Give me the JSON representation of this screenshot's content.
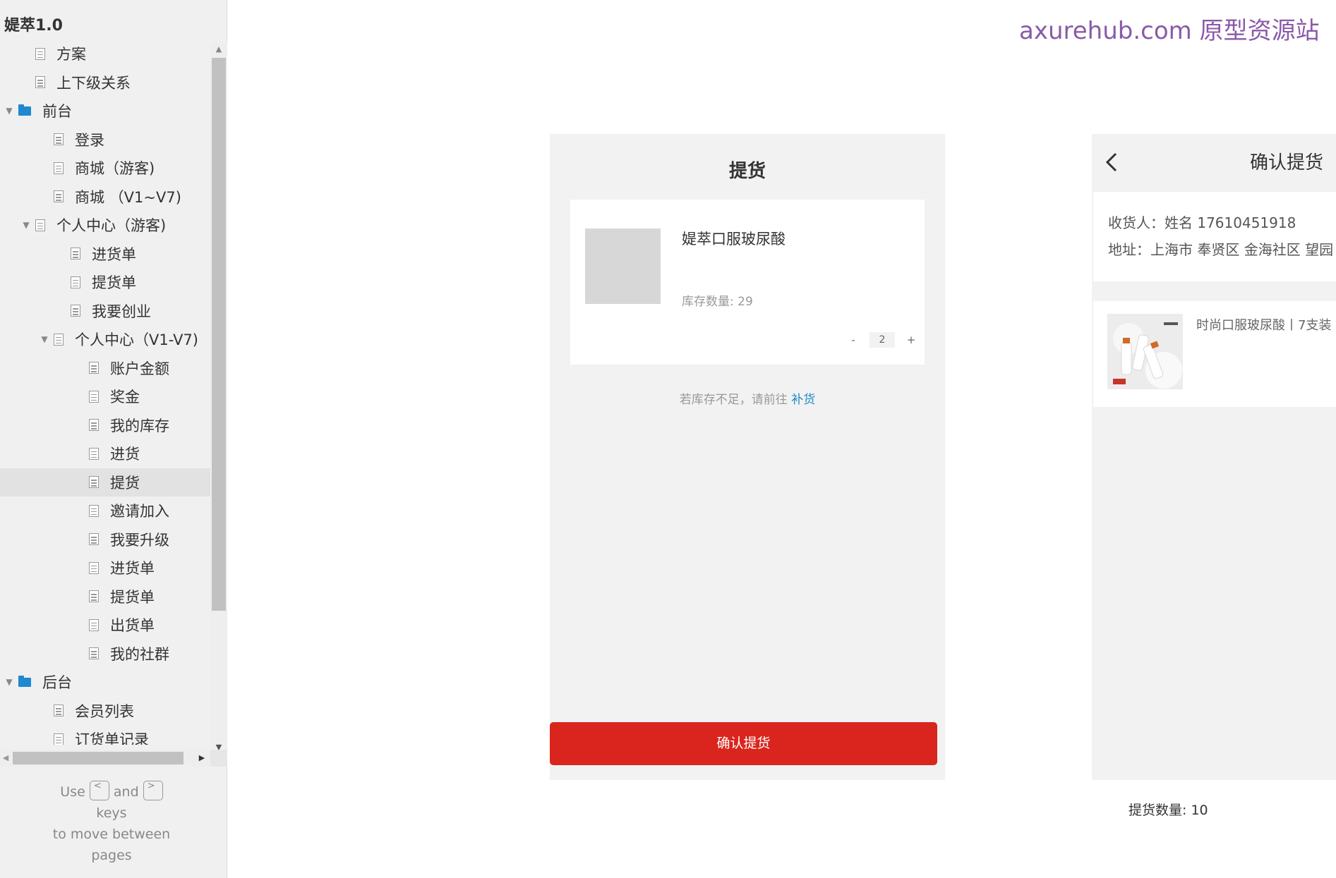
{
  "project": {
    "title": "媞萃1.0"
  },
  "tree": [
    {
      "label": "方案",
      "type": "page",
      "level": 1,
      "arrow": ""
    },
    {
      "label": "上下级关系",
      "type": "page",
      "level": 1,
      "arrow": ""
    },
    {
      "label": "前台",
      "type": "folder",
      "level": 0,
      "arrow": "▼"
    },
    {
      "label": "登录",
      "type": "page",
      "level": 2,
      "arrow": ""
    },
    {
      "label": "商城（游客)",
      "type": "page",
      "level": 2,
      "arrow": ""
    },
    {
      "label": "商城 （V1~V7)",
      "type": "page",
      "level": 2,
      "arrow": ""
    },
    {
      "label": "个人中心（游客)",
      "type": "page",
      "level": 1.5,
      "arrow": "▼"
    },
    {
      "label": "进货单",
      "type": "page",
      "level": 3,
      "arrow": ""
    },
    {
      "label": "提货单",
      "type": "page",
      "level": 3,
      "arrow": ""
    },
    {
      "label": "我要创业",
      "type": "page",
      "level": 3,
      "arrow": ""
    },
    {
      "label": "个人中心（V1-V7)",
      "type": "page",
      "level": 2.5,
      "arrow": "▼"
    },
    {
      "label": "账户金额",
      "type": "page",
      "level": 4,
      "arrow": ""
    },
    {
      "label": "奖金",
      "type": "page",
      "level": 4,
      "arrow": ""
    },
    {
      "label": "我的库存",
      "type": "page",
      "level": 4,
      "arrow": ""
    },
    {
      "label": "进货",
      "type": "page",
      "level": 4,
      "arrow": ""
    },
    {
      "label": "提货",
      "type": "page",
      "level": 4,
      "arrow": "",
      "selected": true
    },
    {
      "label": "邀请加入",
      "type": "page",
      "level": 4,
      "arrow": ""
    },
    {
      "label": "我要升级",
      "type": "page",
      "level": 4,
      "arrow": ""
    },
    {
      "label": "进货单",
      "type": "page",
      "level": 4,
      "arrow": ""
    },
    {
      "label": "提货单",
      "type": "page",
      "level": 4,
      "arrow": ""
    },
    {
      "label": "出货单",
      "type": "page",
      "level": 4,
      "arrow": ""
    },
    {
      "label": "我的社群",
      "type": "page",
      "level": 4,
      "arrow": ""
    },
    {
      "label": "后台",
      "type": "folder",
      "level": 0,
      "arrow": "▼"
    },
    {
      "label": "会员列表",
      "type": "page",
      "level": 2,
      "arrow": ""
    },
    {
      "label": "订货单记录",
      "type": "page",
      "level": 2,
      "arrow": ""
    }
  ],
  "help": {
    "use": "Use",
    "and": "and",
    "keys": "keys",
    "move": "to move between",
    "pages": "pages",
    "key_prev": "<",
    "key_next": ">"
  },
  "watermark": "axurehub.com 原型资源站",
  "pickup": {
    "title": "提货",
    "product_name": "媞萃口服玻尿酸",
    "stock_label": "库存数量:",
    "stock_value": "29",
    "minus": "-",
    "quantity": "2",
    "plus": "+",
    "hint_text": "若库存不足，请前往",
    "hint_link": "补货",
    "confirm_button": "确认提货"
  },
  "confirm": {
    "title": "确认提货",
    "receiver": "收货人：姓名 17610451918",
    "address": "地址：上海市 奉贤区 金海社区 望园",
    "goods_name": "时尚口服玻尿酸丨7支装",
    "pickup_qty_label": "提货数量:",
    "pickup_qty_value": "10"
  }
}
